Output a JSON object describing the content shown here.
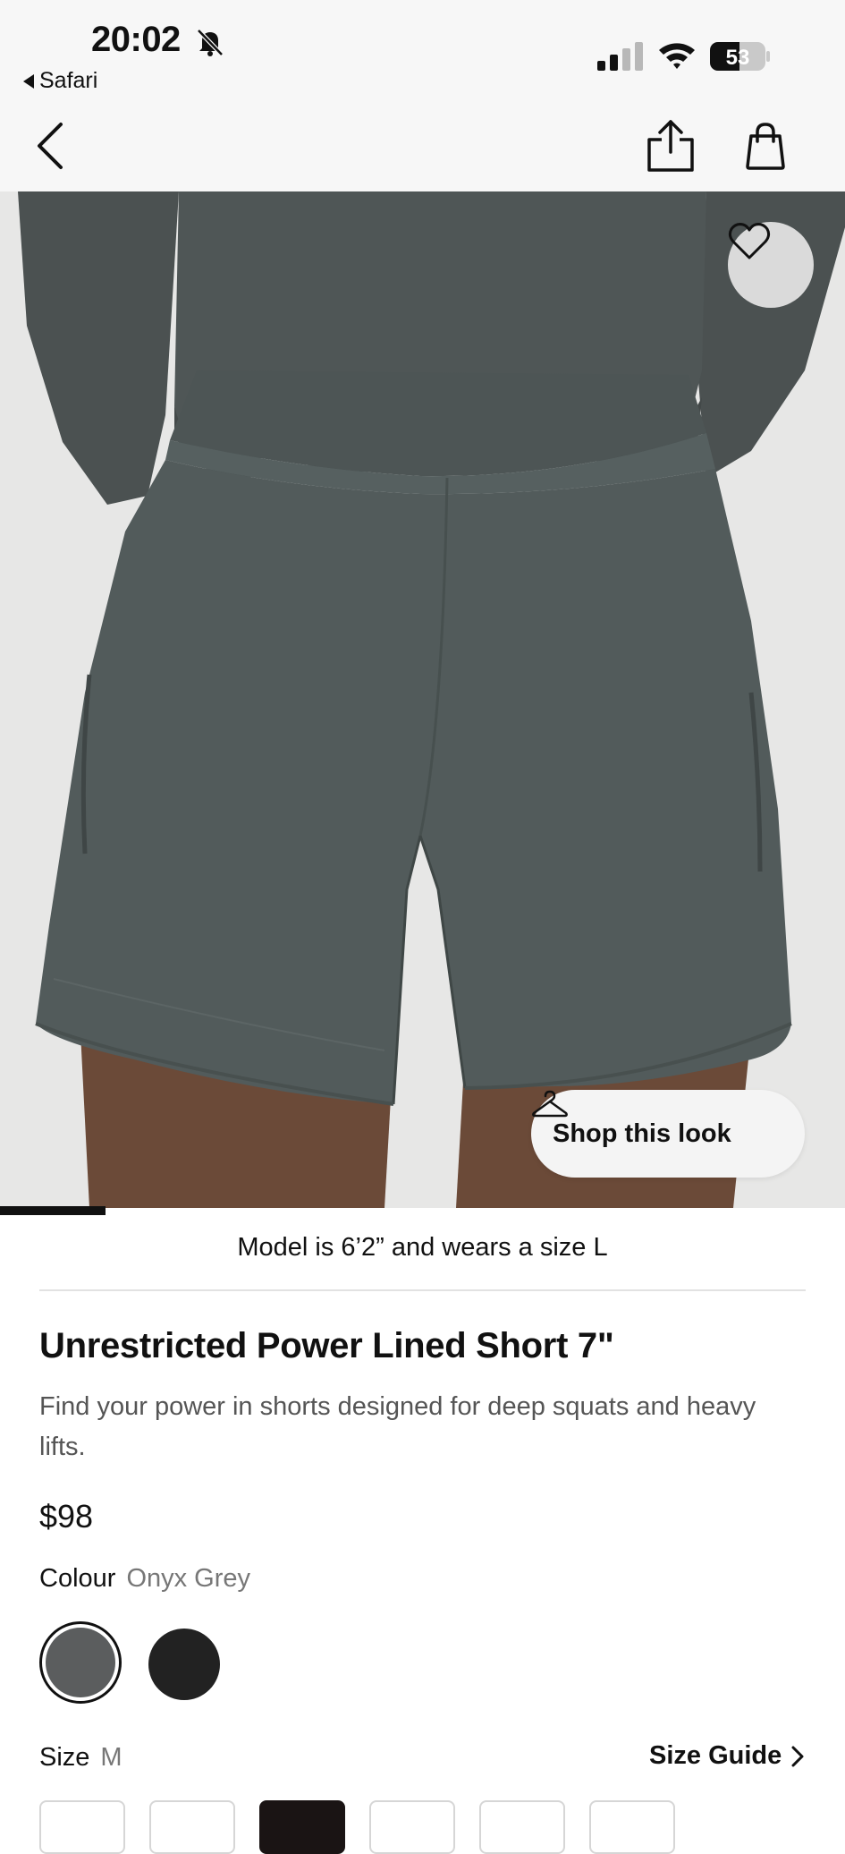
{
  "status_bar": {
    "time": "20:02",
    "back_app": "Safari",
    "battery": "53",
    "icons": [
      "bell-slash-icon",
      "signal-icon",
      "wifi-icon",
      "battery-icon"
    ]
  },
  "nav": {
    "icons": [
      "back-chevron-icon",
      "share-icon",
      "shopping-bag-icon"
    ]
  },
  "hero": {
    "shop_look_label": "Shop this look",
    "icons": [
      "heart-icon",
      "hanger-icon"
    ]
  },
  "product": {
    "model_note": "Model is 6’2” and wears a size L",
    "title": "Unrestricted Power Lined Short 7\"",
    "description": "Find your power in shorts designed for deep squats and heavy lifts.",
    "price": "$98",
    "colour_label": "Colour",
    "colour_value": "Onyx Grey",
    "swatches": [
      {
        "name": "Onyx Grey",
        "color": "#5b5d5e",
        "selected": true
      },
      {
        "name": "Black",
        "color": "#222222",
        "selected": false
      }
    ],
    "size_label": "Size",
    "size_value": "M",
    "size_guide_label": "Size Guide",
    "size_options_selected_index": 2
  },
  "colors": {
    "accent": "#111111",
    "short_fabric": "#525b5b",
    "background": "#e7e7e6"
  }
}
